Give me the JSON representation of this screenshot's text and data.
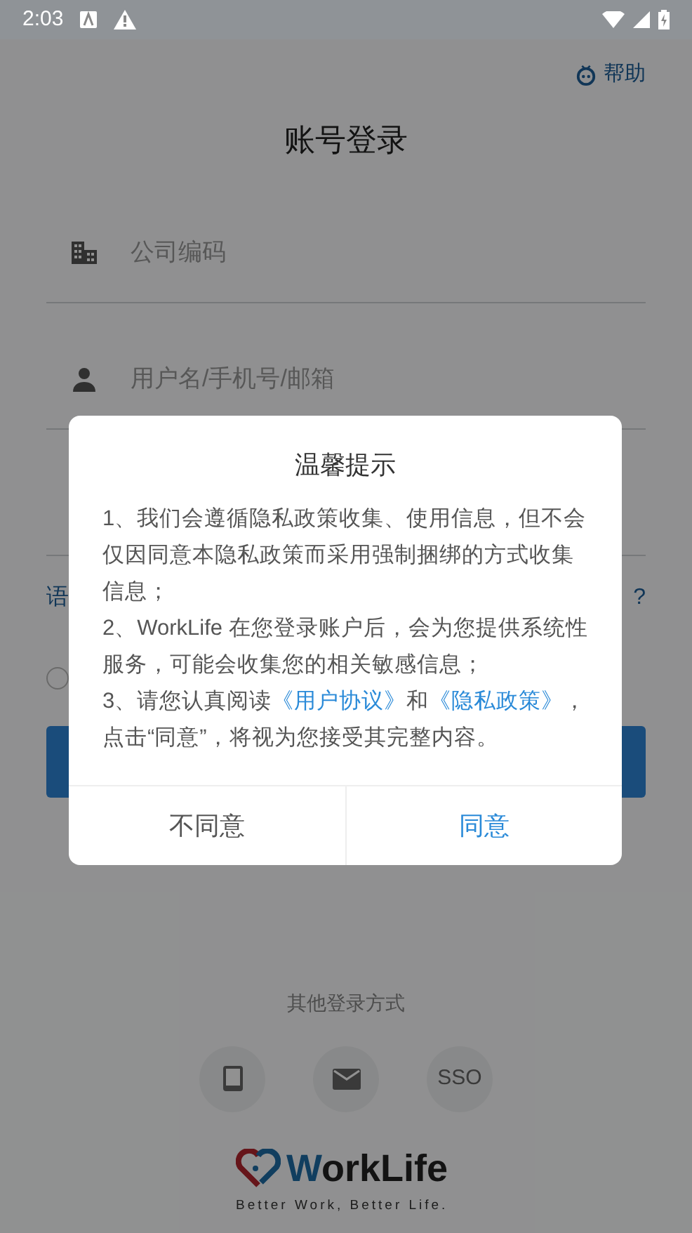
{
  "status_bar": {
    "time": "2:03"
  },
  "help": {
    "label": "帮助"
  },
  "title": "账号登录",
  "fields": [
    {
      "placeholder": "公司编码",
      "kind": "company"
    },
    {
      "placeholder": "用户名/手机号/邮箱",
      "kind": "user"
    },
    {
      "kind": "blank"
    }
  ],
  "language_link": "语",
  "forgot_link": "?",
  "agreement_radio": {
    "checked": false
  },
  "dialog": {
    "title": "温馨提示",
    "paragraphs": [
      {
        "text": "1、我们会遵循隐私政策收集、使用信息，但不会仅因同意本隐私政策而采用强制捆绑的方式收集信息；"
      },
      {
        "text": "2、WorkLife 在您登录账户后，会为您提供系统性服务，可能会收集您的相关敏感信息；"
      },
      {
        "text": "3、请您认真阅读",
        "link1": "《用户协议》",
        "mid": "和",
        "link2": "《隐私政策》",
        "after": "，点击“同意”，将视为您接受其完整内容。"
      }
    ],
    "buttons": [
      {
        "label": "不同意",
        "primary": false
      },
      {
        "label": "同意",
        "primary": true
      }
    ]
  },
  "other_login": {
    "label": "其他登录方式",
    "options": [
      {
        "kind": "phone"
      },
      {
        "kind": "mail"
      },
      {
        "kind": "text",
        "label": "SSO"
      }
    ]
  },
  "logo": {
    "name": "WorkLife",
    "tagline": "Better Work, Better Life."
  }
}
